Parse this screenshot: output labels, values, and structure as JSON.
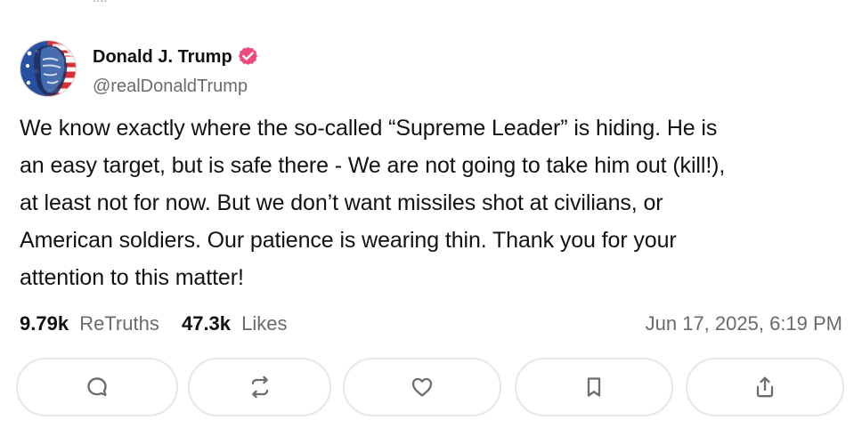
{
  "post": {
    "author": {
      "name": "Donald J. Trump",
      "handle": "@realDonaldTrump",
      "verified_color": "#ef4a7a",
      "avatar_icon": "portrait-avatar-icon"
    },
    "content": {
      "lines": [
        "We know exactly where the so-called “Supreme Leader” is hiding. He is",
        "an easy target, but is safe there - We are not going to take him out (kill!),",
        "at least not for now. But we don’t want missiles shot at civilians, or",
        "American soldiers. Our patience is wearing thin. Thank you for your",
        "attention to this matter!"
      ]
    },
    "stats": {
      "retruths": {
        "value": "9.79k",
        "label": "ReTruths"
      },
      "likes": {
        "value": "47.3k",
        "label": "Likes"
      }
    },
    "timestamp": "Jun 17, 2025, 6:19 PM",
    "actions": [
      {
        "name": "reply",
        "icon": "reply-icon"
      },
      {
        "name": "retruth",
        "icon": "retruth-icon"
      },
      {
        "name": "like",
        "icon": "heart-icon"
      },
      {
        "name": "bookmark",
        "icon": "bookmark-icon"
      },
      {
        "name": "share",
        "icon": "share-icon"
      }
    ],
    "colors": {
      "text": "#111111",
      "muted": "#6b6b6b",
      "border": "#e7e7e7",
      "verified": "#ef4a7a"
    }
  }
}
